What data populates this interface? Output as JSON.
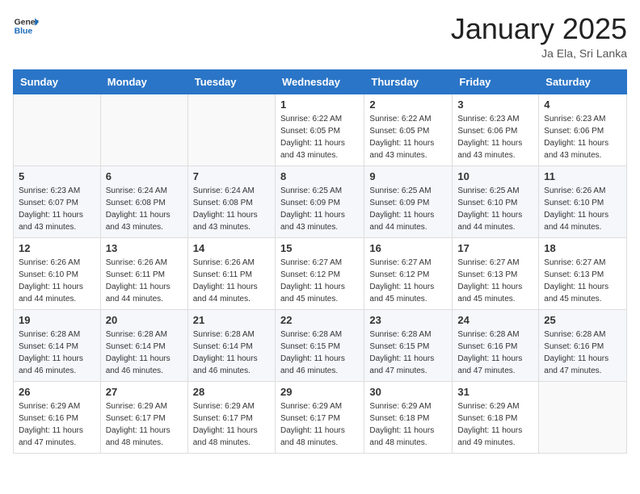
{
  "header": {
    "logo_general": "General",
    "logo_blue": "Blue",
    "month_title": "January 2025",
    "location": "Ja Ela, Sri Lanka"
  },
  "weekdays": [
    "Sunday",
    "Monday",
    "Tuesday",
    "Wednesday",
    "Thursday",
    "Friday",
    "Saturday"
  ],
  "weeks": [
    [
      {
        "day": "",
        "sunrise": "",
        "sunset": "",
        "daylight": ""
      },
      {
        "day": "",
        "sunrise": "",
        "sunset": "",
        "daylight": ""
      },
      {
        "day": "",
        "sunrise": "",
        "sunset": "",
        "daylight": ""
      },
      {
        "day": "1",
        "sunrise": "Sunrise: 6:22 AM",
        "sunset": "Sunset: 6:05 PM",
        "daylight": "Daylight: 11 hours and 43 minutes."
      },
      {
        "day": "2",
        "sunrise": "Sunrise: 6:22 AM",
        "sunset": "Sunset: 6:05 PM",
        "daylight": "Daylight: 11 hours and 43 minutes."
      },
      {
        "day": "3",
        "sunrise": "Sunrise: 6:23 AM",
        "sunset": "Sunset: 6:06 PM",
        "daylight": "Daylight: 11 hours and 43 minutes."
      },
      {
        "day": "4",
        "sunrise": "Sunrise: 6:23 AM",
        "sunset": "Sunset: 6:06 PM",
        "daylight": "Daylight: 11 hours and 43 minutes."
      }
    ],
    [
      {
        "day": "5",
        "sunrise": "Sunrise: 6:23 AM",
        "sunset": "Sunset: 6:07 PM",
        "daylight": "Daylight: 11 hours and 43 minutes."
      },
      {
        "day": "6",
        "sunrise": "Sunrise: 6:24 AM",
        "sunset": "Sunset: 6:08 PM",
        "daylight": "Daylight: 11 hours and 43 minutes."
      },
      {
        "day": "7",
        "sunrise": "Sunrise: 6:24 AM",
        "sunset": "Sunset: 6:08 PM",
        "daylight": "Daylight: 11 hours and 43 minutes."
      },
      {
        "day": "8",
        "sunrise": "Sunrise: 6:25 AM",
        "sunset": "Sunset: 6:09 PM",
        "daylight": "Daylight: 11 hours and 43 minutes."
      },
      {
        "day": "9",
        "sunrise": "Sunrise: 6:25 AM",
        "sunset": "Sunset: 6:09 PM",
        "daylight": "Daylight: 11 hours and 44 minutes."
      },
      {
        "day": "10",
        "sunrise": "Sunrise: 6:25 AM",
        "sunset": "Sunset: 6:10 PM",
        "daylight": "Daylight: 11 hours and 44 minutes."
      },
      {
        "day": "11",
        "sunrise": "Sunrise: 6:26 AM",
        "sunset": "Sunset: 6:10 PM",
        "daylight": "Daylight: 11 hours and 44 minutes."
      }
    ],
    [
      {
        "day": "12",
        "sunrise": "Sunrise: 6:26 AM",
        "sunset": "Sunset: 6:10 PM",
        "daylight": "Daylight: 11 hours and 44 minutes."
      },
      {
        "day": "13",
        "sunrise": "Sunrise: 6:26 AM",
        "sunset": "Sunset: 6:11 PM",
        "daylight": "Daylight: 11 hours and 44 minutes."
      },
      {
        "day": "14",
        "sunrise": "Sunrise: 6:26 AM",
        "sunset": "Sunset: 6:11 PM",
        "daylight": "Daylight: 11 hours and 44 minutes."
      },
      {
        "day": "15",
        "sunrise": "Sunrise: 6:27 AM",
        "sunset": "Sunset: 6:12 PM",
        "daylight": "Daylight: 11 hours and 45 minutes."
      },
      {
        "day": "16",
        "sunrise": "Sunrise: 6:27 AM",
        "sunset": "Sunset: 6:12 PM",
        "daylight": "Daylight: 11 hours and 45 minutes."
      },
      {
        "day": "17",
        "sunrise": "Sunrise: 6:27 AM",
        "sunset": "Sunset: 6:13 PM",
        "daylight": "Daylight: 11 hours and 45 minutes."
      },
      {
        "day": "18",
        "sunrise": "Sunrise: 6:27 AM",
        "sunset": "Sunset: 6:13 PM",
        "daylight": "Daylight: 11 hours and 45 minutes."
      }
    ],
    [
      {
        "day": "19",
        "sunrise": "Sunrise: 6:28 AM",
        "sunset": "Sunset: 6:14 PM",
        "daylight": "Daylight: 11 hours and 46 minutes."
      },
      {
        "day": "20",
        "sunrise": "Sunrise: 6:28 AM",
        "sunset": "Sunset: 6:14 PM",
        "daylight": "Daylight: 11 hours and 46 minutes."
      },
      {
        "day": "21",
        "sunrise": "Sunrise: 6:28 AM",
        "sunset": "Sunset: 6:14 PM",
        "daylight": "Daylight: 11 hours and 46 minutes."
      },
      {
        "day": "22",
        "sunrise": "Sunrise: 6:28 AM",
        "sunset": "Sunset: 6:15 PM",
        "daylight": "Daylight: 11 hours and 46 minutes."
      },
      {
        "day": "23",
        "sunrise": "Sunrise: 6:28 AM",
        "sunset": "Sunset: 6:15 PM",
        "daylight": "Daylight: 11 hours and 47 minutes."
      },
      {
        "day": "24",
        "sunrise": "Sunrise: 6:28 AM",
        "sunset": "Sunset: 6:16 PM",
        "daylight": "Daylight: 11 hours and 47 minutes."
      },
      {
        "day": "25",
        "sunrise": "Sunrise: 6:28 AM",
        "sunset": "Sunset: 6:16 PM",
        "daylight": "Daylight: 11 hours and 47 minutes."
      }
    ],
    [
      {
        "day": "26",
        "sunrise": "Sunrise: 6:29 AM",
        "sunset": "Sunset: 6:16 PM",
        "daylight": "Daylight: 11 hours and 47 minutes."
      },
      {
        "day": "27",
        "sunrise": "Sunrise: 6:29 AM",
        "sunset": "Sunset: 6:17 PM",
        "daylight": "Daylight: 11 hours and 48 minutes."
      },
      {
        "day": "28",
        "sunrise": "Sunrise: 6:29 AM",
        "sunset": "Sunset: 6:17 PM",
        "daylight": "Daylight: 11 hours and 48 minutes."
      },
      {
        "day": "29",
        "sunrise": "Sunrise: 6:29 AM",
        "sunset": "Sunset: 6:17 PM",
        "daylight": "Daylight: 11 hours and 48 minutes."
      },
      {
        "day": "30",
        "sunrise": "Sunrise: 6:29 AM",
        "sunset": "Sunset: 6:18 PM",
        "daylight": "Daylight: 11 hours and 48 minutes."
      },
      {
        "day": "31",
        "sunrise": "Sunrise: 6:29 AM",
        "sunset": "Sunset: 6:18 PM",
        "daylight": "Daylight: 11 hours and 49 minutes."
      },
      {
        "day": "",
        "sunrise": "",
        "sunset": "",
        "daylight": ""
      }
    ]
  ]
}
